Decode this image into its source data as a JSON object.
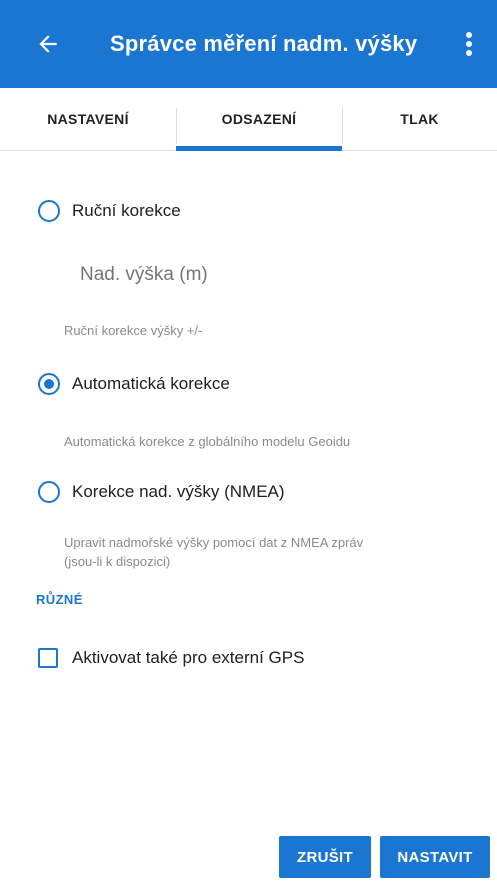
{
  "app_bar": {
    "title": "Správce měření nadm. výšky",
    "back_icon": "arrow-left-icon",
    "menu_icon": "more-vert-icon"
  },
  "tabs": [
    {
      "label": "NASTAVENÍ",
      "selected": false
    },
    {
      "label": "ODSAZENÍ",
      "selected": true
    },
    {
      "label": "TLAK",
      "selected": false
    }
  ],
  "options": {
    "manual": {
      "label": "Ruční korekce",
      "checked": false,
      "input_placeholder": "Nad. výška (m)",
      "description": "Ruční korekce výšky +/-"
    },
    "automatic": {
      "label": "Automatická korekce",
      "checked": true,
      "description": "Automatická korekce z globálního modelu Geoidu"
    },
    "nmea": {
      "label": "Korekce nad. výšky (NMEA)",
      "checked": false,
      "description_line1": "Upravit nadmořské výšky pomocí dat z NMEA zpráv",
      "description_line2": "(jsou-li k dispozici)"
    }
  },
  "misc": {
    "section_title": "RŮZNÉ",
    "external_gps_label": "Aktivovat také pro externí GPS",
    "external_gps_checked": false
  },
  "buttons": {
    "cancel": "ZRUŠIT",
    "set": "NASTAVIT"
  },
  "colors": {
    "primary": "#1b76d2",
    "text": "#202020",
    "secondary_text": "#8a8a8a"
  }
}
